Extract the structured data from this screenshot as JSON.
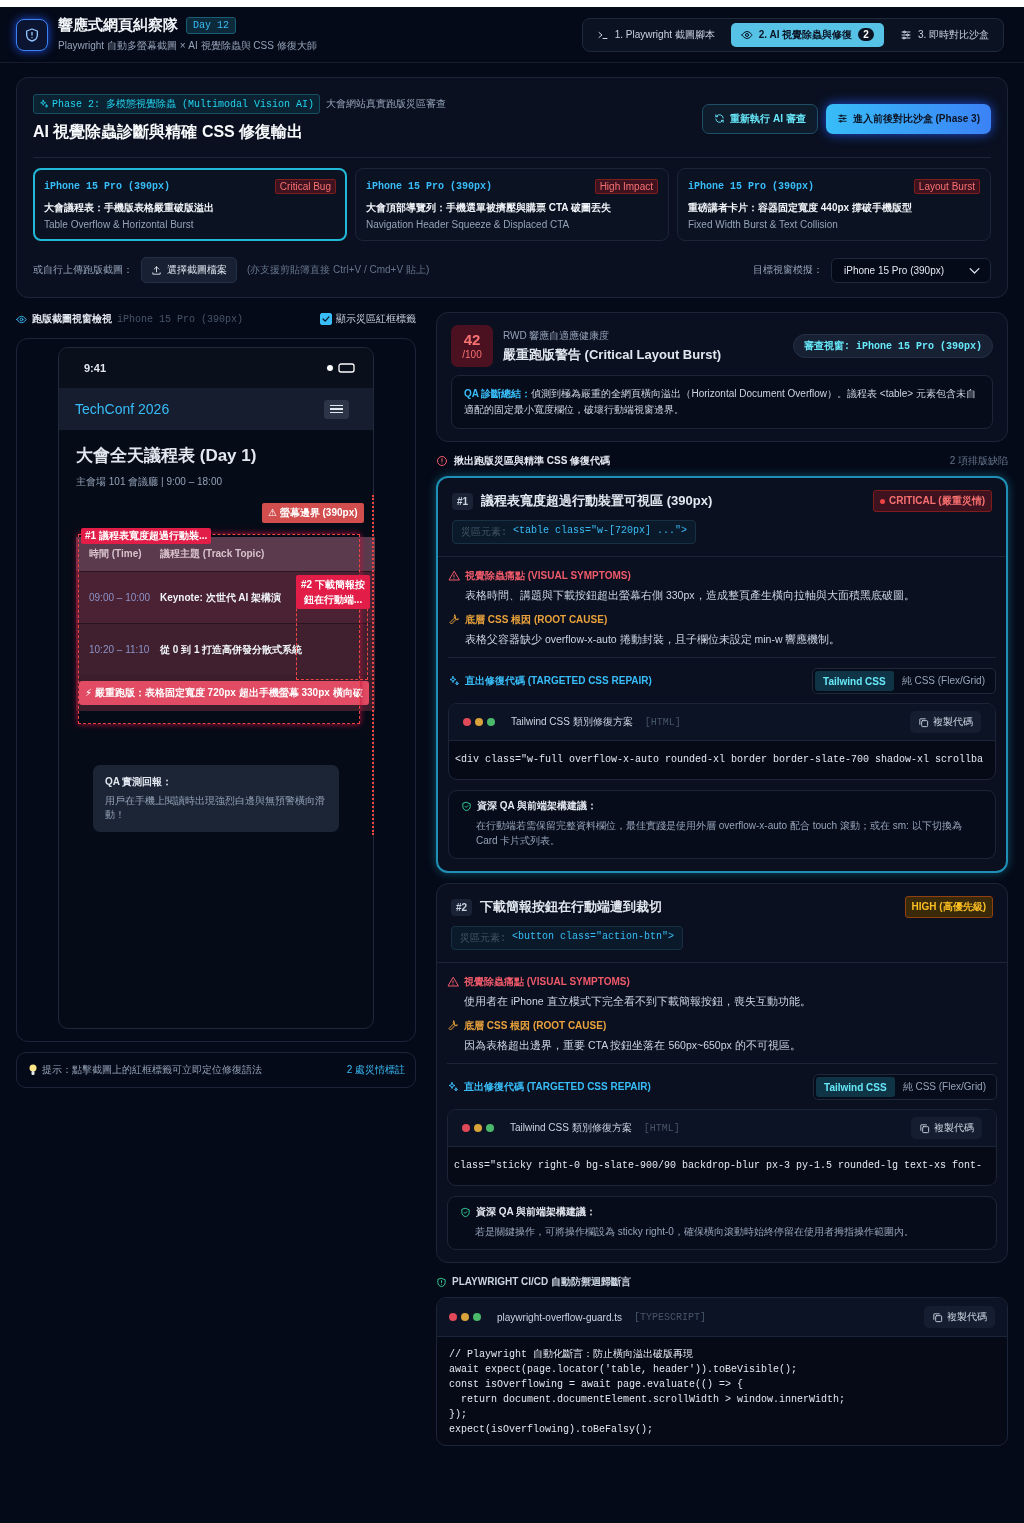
{
  "header": {
    "title": "響應式網頁糾察隊",
    "badge": "Day 12",
    "subtitle": "Playwright 自動多螢幕截圖 × AI 視覺除蟲與 CSS 修復大師"
  },
  "steps": [
    {
      "label": "1. Playwright 截圖腳本",
      "selected": false
    },
    {
      "label": "2. AI 視覺除蟲與修復",
      "selected": true,
      "count": "2"
    },
    {
      "label": "3. 即時對比沙盒",
      "selected": false
    }
  ],
  "phase": {
    "tag": "Phase 2: 多模態視覺除蟲 (Multimodal Vision AI)",
    "caption": "大會網站真實跑版災區審查",
    "title": "AI 視覺除蟲診斷與精確 CSS 修復輸出",
    "buttons": [
      {
        "label": "重新執行 AI 審查",
        "kind": "secondary"
      },
      {
        "label": "進入前後對比沙盒 (Phase 3)",
        "kind": "primary"
      }
    ],
    "scenarios": [
      {
        "device": "iPhone 15 Pro (390px)",
        "tag": "Critical Bug",
        "title": "大會議程表：手機版表格嚴重破版溢出",
        "subtitle": "Table Overflow & Horizontal Burst",
        "selected": true
      },
      {
        "device": "iPhone 15 Pro (390px)",
        "tag": "High Impact",
        "title": "大會頂部導覽列：手機選單被擠壓與購票 CTA 破圖丟失",
        "subtitle": "Navigation Header Squeeze & Displaced CTA",
        "selected": false
      },
      {
        "device": "iPhone 15 Pro (390px)",
        "tag": "Layout Burst",
        "title": "重磅講者卡片：容器固定寬度 440px 撐破手機版型",
        "subtitle": "Fixed Width Burst & Text Collision",
        "selected": false
      }
    ],
    "upload": {
      "label": "或自行上傳跑版截圖：",
      "button": "選擇截圖檔案",
      "hint": "(亦支援剪貼簿直接 Ctrl+V / Cmd+V 貼上)"
    },
    "viewport": {
      "label": "目標視窗模擬：",
      "value": "iPhone 15 Pro (390px)"
    }
  },
  "preview": {
    "title": "跑版截圖視窗檢視",
    "device": "iPhone 15 Pro (390px)",
    "show_labels": {
      "label": "顯示災區紅框標籤",
      "checked": true
    },
    "phone": {
      "time": "9:41",
      "brand": "TechConf 2026",
      "heading": "大會全天議程表 (Day 1)",
      "venue": "主會場 101 會議廳 | 9:00 – 18:00",
      "boundary": "⚠ 螢幕邊界 (390px)",
      "columns": [
        "時間 (Time)",
        "議程主題 (Track Topic)"
      ],
      "rows": [
        {
          "time": "09:00 – 10:00",
          "topic": "Keynote: 次世代 AI 架構演"
        },
        {
          "time": "10:20 – 11:10",
          "topic": "從 0 到 1 打造高併發分散式系統"
        }
      ],
      "markers": [
        "#1 議程表寬度超過行動裝...",
        "#2 下載簡報按鈕在行動端..."
      ],
      "alert": "⚡ 嚴重跑版：表格固定寬度 720px 超出手機螢幕 330px 橫向破",
      "qa_title": "QA 實測回報：",
      "qa_text": "用戶在手機上閱讀時出現強烈白邊與無預警橫向滑動！"
    },
    "hint": "提示：點擊截圖上的紅框標籤可立即定位修復語法",
    "count": "2 處災情標註"
  },
  "report": {
    "score": "42",
    "score_max": "/100",
    "caption": "RWD 響應自適應健康度",
    "title": "嚴重跑版警告 (Critical Layout Burst)",
    "viewport": "審查視窗: iPhone 15 Pro (390px)",
    "summary": "**QA 診斷總結：**偵測到極為嚴重的全網頁橫向溢出（Horizontal Document Overflow）。議程表 <table> 元素包含未自適配的固定最小寬度欄位，破壞行動端視窗邊界。"
  },
  "issues_header": {
    "title": "揪出跑版災區與精準 CSS 修復代碼",
    "count": "2 項排版缺陷"
  },
  "issues": [
    {
      "number": "#1",
      "title": "議程表寬度超過行動裝置可視區 (390px)",
      "severity": "CRITICAL (嚴重災情)",
      "kind": "critical",
      "selected": true,
      "element_label": "災區元素:",
      "element_code": "<table class=\"w-[720px] ...\">",
      "symptoms_label": "視覺除蟲痛點 (VISUAL SYMPTOMS)",
      "symptoms": "表格時間、講題與下載按鈕超出螢幕右側 330px，造成整頁產生橫向拉軸與大面積黑底破圖。",
      "cause_label": "底層 CSS 根因 (ROOT CAUSE)",
      "cause": "表格父容器缺少 overflow-x-auto 捲動封裝，且子欄位未設定 min-w 響應機制。",
      "repair_label": "直出修復代碼 (TARGETED CSS REPAIR)",
      "tabs": [
        {
          "label": "Tailwind CSS",
          "selected": true
        },
        {
          "label": "純 CSS (Flex/Grid)",
          "selected": false
        }
      ],
      "code_title": "Tailwind CSS 類別修復方案",
      "code_lang": "[HTML]",
      "copy": "複製代碼",
      "code": "<div class=\"w-full overflow-x-auto rounded-xl border border-slate-700 shadow-xl scrollba",
      "advice_title": "資深 QA 與前端架構建議：",
      "advice": "在行動端若需保留完整資料欄位，最佳實踐是使用外層 overflow-x-auto 配合 touch 滾動；或在 sm: 以下切換為 Card 卡片式列表。"
    },
    {
      "number": "#2",
      "title": "下載簡報按鈕在行動端遭到裁切",
      "severity": "HIGH (高優先級)",
      "kind": "high",
      "selected": false,
      "element_label": "災區元素:",
      "element_code": "<button class=\"action-btn\">",
      "symptoms_label": "視覺除蟲痛點 (VISUAL SYMPTOMS)",
      "symptoms": "使用者在 iPhone 直立模式下完全看不到下載簡報按鈕，喪失互動功能。",
      "cause_label": "底層 CSS 根因 (ROOT CAUSE)",
      "cause": "因為表格超出邊界，重要 CTA 按鈕坐落在 560px~650px 的不可視區。",
      "repair_label": "直出修復代碼 (TARGETED CSS REPAIR)",
      "tabs": [
        {
          "label": "Tailwind CSS",
          "selected": true
        },
        {
          "label": "純 CSS (Flex/Grid)",
          "selected": false
        }
      ],
      "code_title": "Tailwind CSS 類別修復方案",
      "code_lang": "[HTML]",
      "copy": "複製代碼",
      "code": "class=\"sticky right-0 bg-slate-900/90 backdrop-blur px-3 py-1.5 rounded-lg text-xs font-",
      "advice_title": "資深 QA 與前端架構建議：",
      "advice": "若是關鍵操作，可將操作欄設為 sticky right-0，確保橫向滾動時始終停留在使用者拇指操作範圍內。"
    }
  ],
  "ci": {
    "title": "PLAYWRIGHT CI/CD 自動防禦迴歸斷言",
    "file": "playwright-overflow-guard.ts",
    "lang": "[TYPESCRIPT]",
    "copy": "複製代碼",
    "lines": [
      "// Playwright 自動化斷言：防止橫向溢出破版再現",
      "await expect(page.locator('table, header')).toBeVisible();",
      "const isOverflowing = await page.evaluate(() => {",
      "  return document.documentElement.scrollWidth > window.innerWidth;",
      "});",
      "expect(isOverflowing).toBeFalsy();"
    ]
  }
}
